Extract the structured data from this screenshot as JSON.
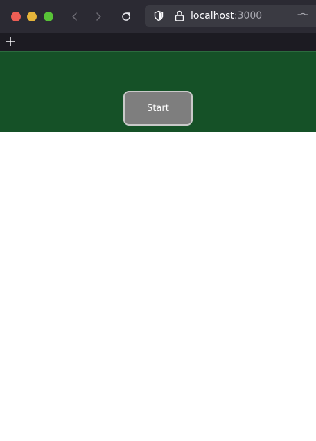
{
  "browser": {
    "url_host": "localhost",
    "url_port": ":3000",
    "icons": {
      "back": "chevron-left-icon",
      "forward": "chevron-right-icon",
      "reload": "reload-icon",
      "shield": "shield-icon",
      "lock": "lock-icon",
      "add_tab": "plus-icon"
    }
  },
  "main": {
    "start_label": "Start"
  },
  "colors": {
    "chrome_bg": "#2b2a33",
    "hero_bg": "#155127",
    "button_bg": "#7e7e7e",
    "button_border": "#c9c9c9"
  }
}
